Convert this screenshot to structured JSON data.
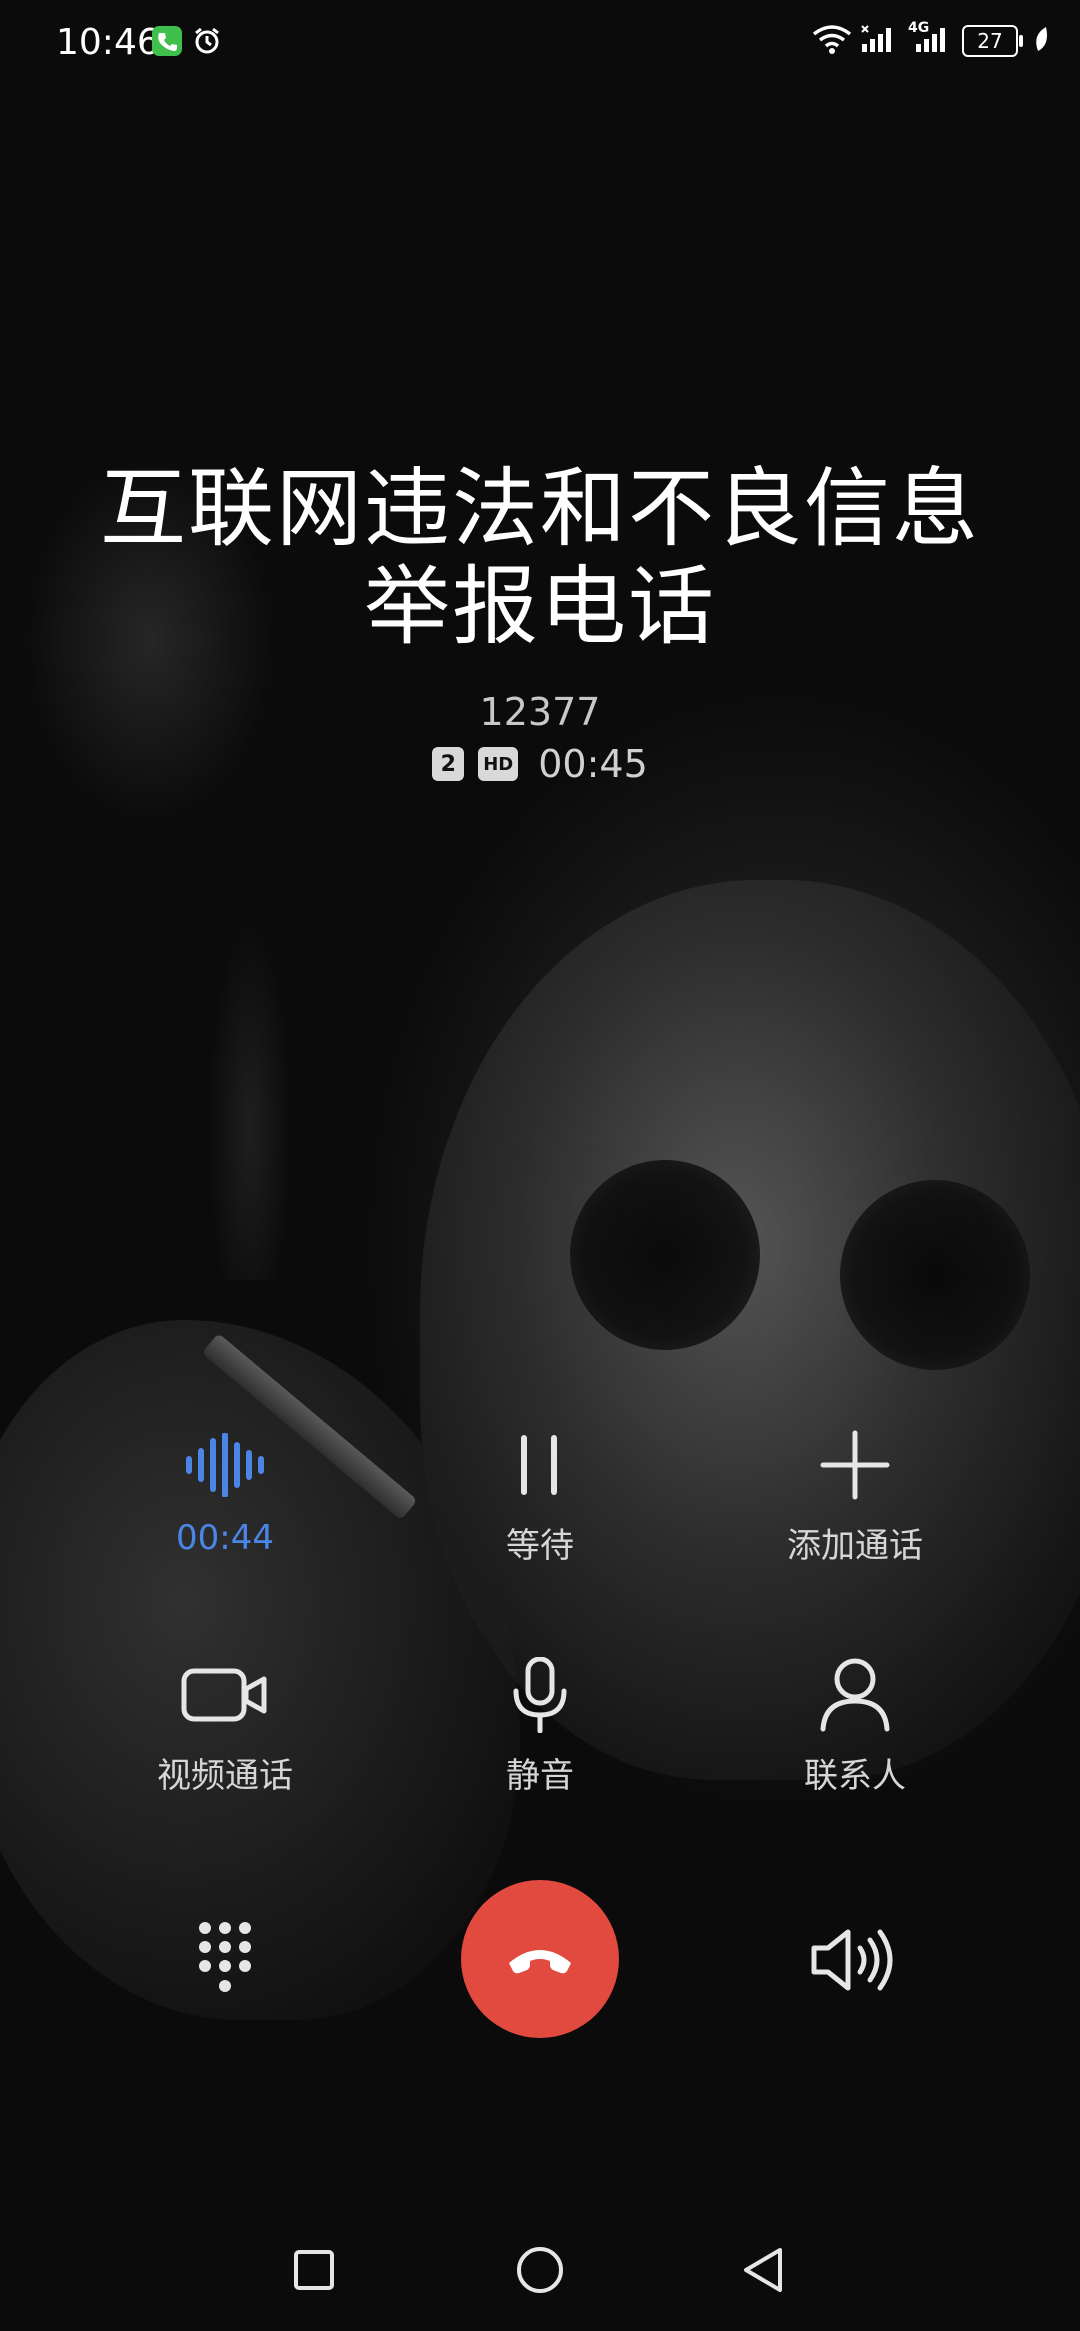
{
  "status_bar": {
    "time": "10:46",
    "battery_level": "27",
    "network_label": "4G",
    "icons": [
      "phone-call-icon",
      "alarm-icon",
      "wifi-icon",
      "signal-icon",
      "signal-4g-icon",
      "battery-icon",
      "leaf-icon"
    ]
  },
  "caller": {
    "name": "互联网违法和不良信息举报电话",
    "number": "12377",
    "sim_slot": "2",
    "hd_badge": "HD",
    "duration": "00:45"
  },
  "actions": {
    "recording": {
      "label": "00:44",
      "icon": "voice-wave-icon",
      "color": "#4b86e6"
    },
    "hold": {
      "label": "等待",
      "icon": "pause-icon"
    },
    "add_call": {
      "label": "添加通话",
      "icon": "plus-icon"
    },
    "video_call": {
      "label": "视频通话",
      "icon": "video-camera-icon"
    },
    "mute": {
      "label": "静音",
      "icon": "microphone-icon"
    },
    "contacts": {
      "label": "联系人",
      "icon": "person-icon"
    }
  },
  "bottom_controls": {
    "dialpad": {
      "icon": "dialpad-icon"
    },
    "end_call": {
      "icon": "hang-up-icon",
      "color": "#e24a3f"
    },
    "speaker": {
      "icon": "speaker-icon"
    }
  },
  "nav_bar": {
    "buttons": [
      "recents-square-icon",
      "home-circle-icon",
      "back-triangle-icon"
    ]
  }
}
